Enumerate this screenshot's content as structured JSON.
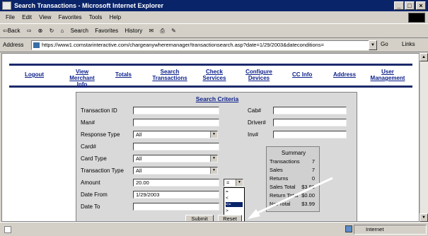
{
  "window": {
    "title": "Search Transactions - Microsoft Internet Explorer",
    "controls": [
      "_",
      "□",
      "×"
    ]
  },
  "menu": {
    "items": [
      "File",
      "Edit",
      "View",
      "Favorites",
      "Tools",
      "Help"
    ]
  },
  "toolbar": {
    "back": "⇦Back",
    "forward": "⇨",
    "stop": "⊗",
    "refresh": "↻",
    "home": "⌂",
    "search": "Search",
    "favorites": "Favorites",
    "history": "History",
    "mail": "✉",
    "print": "⎙",
    "edit": "✎"
  },
  "address": {
    "label": "Address",
    "url": "https://www1.comstarinteractive.com/chargeanywheremanager/transactionsearch.asp?date=1/29/2003&dateconditions=",
    "go": "Go",
    "links": "Links"
  },
  "nav": {
    "items": [
      {
        "label": "Logout"
      },
      {
        "label": "View Merchant Info"
      },
      {
        "label": "Totals"
      },
      {
        "label": "Search Transactions"
      },
      {
        "label": "Check Services"
      },
      {
        "label": "Configure Devices"
      },
      {
        "label": "CC Info"
      },
      {
        "label": "Address"
      },
      {
        "label": "User Management"
      }
    ]
  },
  "search": {
    "title": "Search Criteria",
    "labels": {
      "transaction_id": "Transaction ID",
      "man": "Man#",
      "response_type": "Response Type",
      "card": "Card#",
      "card_type": "Card Type",
      "transaction_type": "Transaction Type",
      "amount": "Amount",
      "date_from": "Date From",
      "date_to": "Date To",
      "cab": "Cab#",
      "driver": "Driver#",
      "inv": "Inv#"
    },
    "values": {
      "transaction_id": "",
      "man": "",
      "response_type": "All",
      "card": "",
      "card_type": "All",
      "transaction_type": "All",
      "amount": "20.00",
      "amount_operator": "=",
      "date_from": "1/29/2003",
      "date_to": "",
      "cab": "",
      "driver": "",
      "inv": ""
    },
    "operator_options": [
      "=",
      "<",
      "<=",
      ">",
      ">="
    ],
    "submit": "Submit",
    "reset": "Reset"
  },
  "summary": {
    "title": "Summary",
    "rows": [
      {
        "label": "Transactions",
        "value": "7"
      },
      {
        "label": "Sales",
        "value": "7"
      },
      {
        "label": "Returns",
        "value": "0"
      },
      {
        "label": "Sales Total",
        "value": "$3.99"
      },
      {
        "label": "Return Total",
        "value": "$0.00"
      },
      {
        "label": "Net Total",
        "value": "$3.99"
      }
    ]
  },
  "status": {
    "zone": "Internet"
  }
}
